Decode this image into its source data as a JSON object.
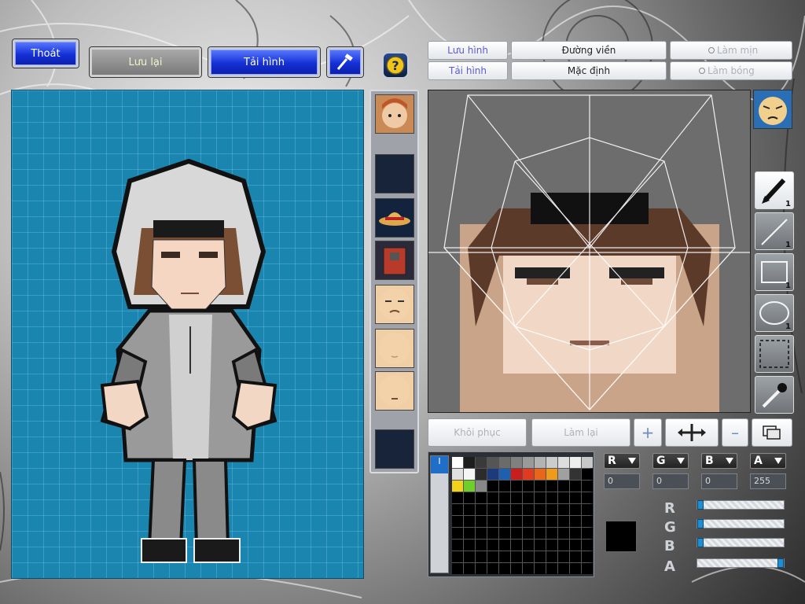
{
  "top_bar": {
    "exit_label": "Thoát",
    "save_label": "Lưu lại",
    "reload_label": "Tải hình",
    "tool_icon": "hammer-icon",
    "help_icon": "question-mark-icon"
  },
  "editor_toolbar": {
    "save_label": "Lưu hình",
    "reload_label": "Tải hình",
    "outline_label": "Đường viền",
    "default_label": "Mặc định",
    "smooth_label": "Làm mịn",
    "shading_label": "Làm bóng"
  },
  "face_strip": {
    "items": [
      "character-face-1",
      "empty-slot",
      "straw-hat",
      "armor-body",
      "face-frown",
      "face-blank",
      "face-neutral",
      "empty-slot"
    ]
  },
  "tools": [
    {
      "icon": "pen-icon",
      "count": "1"
    },
    {
      "icon": "line-icon",
      "count": "1"
    },
    {
      "icon": "rectangle-icon",
      "count": "1"
    },
    {
      "icon": "ellipse-icon",
      "count": "1"
    },
    {
      "icon": "selection-icon",
      "count": ""
    },
    {
      "icon": "eyedropper-icon",
      "count": ""
    }
  ],
  "actions": {
    "restore_label": "Khôi phục",
    "redo_label": "Làm lại",
    "add_icon": "plus-icon",
    "move_icon": "move-arrows-icon",
    "minus_icon": "minus-icon",
    "layers_icon": "layers-icon"
  },
  "palette": {
    "colors_row1": [
      "#ffffff",
      "#1e1e1e",
      "#3a3a3a",
      "#555555",
      "#6b6b6b",
      "#808080",
      "#9a9a9a",
      "#b3b3b3",
      "#cccccc",
      "#dddddd",
      "#eeeeee",
      "#c8c8c8"
    ],
    "colors_row2": [
      "#e0e0e0",
      "#f5f5f5",
      "#2c2c2c",
      "#1d3a7a",
      "#1f5fb0",
      "#c81e1e",
      "#e03b1f",
      "#e8651c",
      "#ef9a1a",
      "#a0a0a0",
      "#333333",
      "#000000"
    ],
    "colors_row3": [
      "#f2d21b",
      "#6fcf2a",
      "#888888"
    ]
  },
  "color_channels": {
    "r_value": "0",
    "g_value": "0",
    "b_value": "0",
    "a_value": "255",
    "sliders": [
      {
        "label": "R",
        "value": 0
      },
      {
        "label": "G",
        "value": 0
      },
      {
        "label": "B",
        "value": 0
      },
      {
        "label": "A",
        "value": 255
      }
    ],
    "current_color": "#000000"
  }
}
